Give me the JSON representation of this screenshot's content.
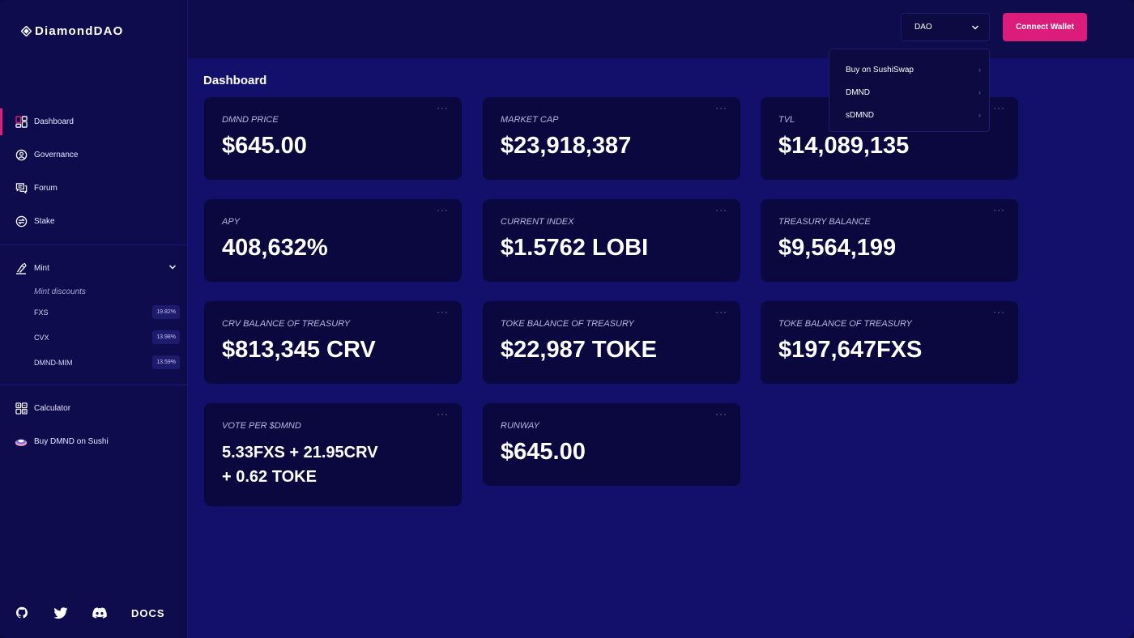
{
  "brand": {
    "name": "DiamondDAO"
  },
  "sidebar": {
    "items": [
      {
        "label": "Dashboard",
        "icon": "dashboard-icon",
        "active": true
      },
      {
        "label": "Governance",
        "icon": "governance-icon"
      },
      {
        "label": "Forum",
        "icon": "forum-icon"
      },
      {
        "label": "Stake",
        "icon": "stake-icon"
      }
    ],
    "mint": {
      "label": "Mint",
      "sub_title": "Mint discounts",
      "discounts": [
        {
          "label": "FXS",
          "value": "19.82%"
        },
        {
          "label": "CVX",
          "value": "13.98%"
        },
        {
          "label": "DMND-MIM",
          "value": "13.59%"
        }
      ]
    },
    "bottom_items": [
      {
        "label": "Calculator",
        "icon": "calculator-icon"
      },
      {
        "label": "Buy DMND on Sushi",
        "icon": "sushi-icon"
      }
    ],
    "footer": {
      "docs_label": "DOCS"
    }
  },
  "topbar": {
    "selector_value": "DAO",
    "connect_label": "Connect Wallet"
  },
  "dropdown": {
    "items": [
      "Buy on SushiSwap",
      "DMND",
      "sDMND"
    ]
  },
  "main": {
    "title": "Dashboard",
    "menu_glyph": "···",
    "cards": [
      {
        "label": "DMND PRICE",
        "value": "$645.00"
      },
      {
        "label": "MARKET CAP",
        "value": "$23,918,387"
      },
      {
        "label": "TVL",
        "value": "$14,089,135"
      },
      {
        "label": "APY",
        "value": "408,632%"
      },
      {
        "label": "CURRENT INDEX",
        "value": "$1.5762 LOBI"
      },
      {
        "label": "TREASURY BALANCE",
        "value": "$9,564,199"
      },
      {
        "label": "CRV BALANCE OF TREASURY",
        "value": "$813,345 CRV"
      },
      {
        "label": "TOKE BALANCE OF TREASURY",
        "value": "$22,987 TOKE"
      },
      {
        "label": "TOKE BALANCE OF TREASURY",
        "value": "$197,647FXS"
      },
      {
        "label": "VOTE PER $DMND",
        "value_line1": "5.33FXS + 21.95CRV",
        "value_line2": "+ 0.62 TOKE"
      },
      {
        "label": "RUNWAY",
        "value": "$645.00"
      }
    ]
  },
  "colors": {
    "accent": "#dc1c7b",
    "background": "#12106a",
    "sidebar": "#0e0c4c",
    "card": "#0a083e"
  }
}
